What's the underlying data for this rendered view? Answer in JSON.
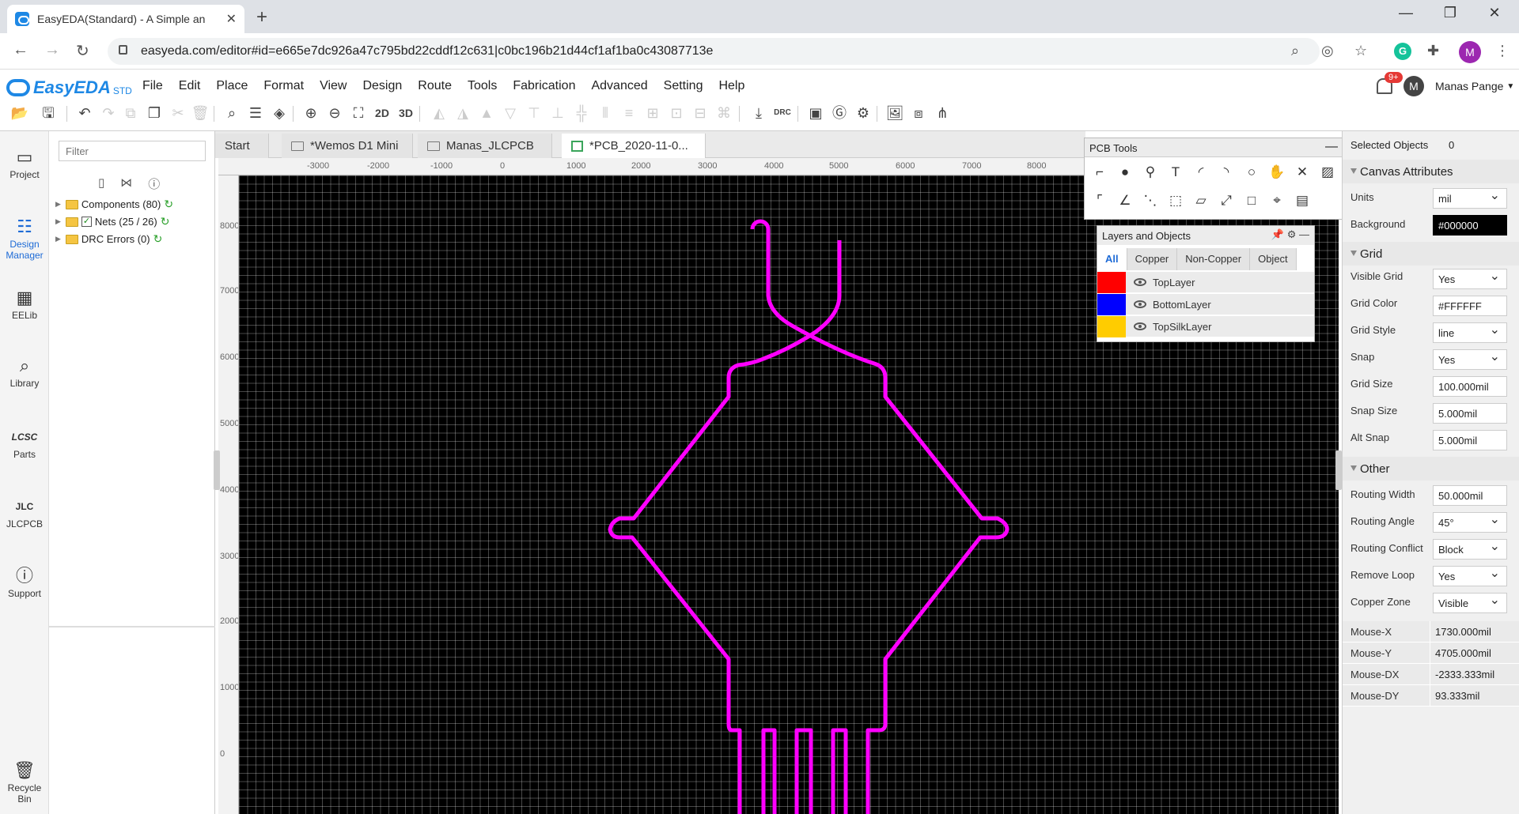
{
  "browser": {
    "tab_title": "EasyEDA(Standard) - A Simple an",
    "url": "easyeda.com/editor#id=e665e7dc926a47c795bd22cddf12c631|c0bc196b21d44cf1af1ba0c43087713e",
    "profile_initial": "M"
  },
  "app": {
    "logo": "EasyEDA",
    "logo_suffix": "STD",
    "menu": [
      "File",
      "Edit",
      "Place",
      "Format",
      "View",
      "Design",
      "Route",
      "Tools",
      "Fabrication",
      "Advanced",
      "Setting",
      "Help"
    ],
    "notification_badge": "9+",
    "user_initial": "M",
    "user_name": "Manas Pange",
    "toolbar_2d": "2D",
    "toolbar_3d": "3D",
    "toolbar_drc": "DRC"
  },
  "sidebar": [
    {
      "label": "Project",
      "icon": "folder-icon"
    },
    {
      "label": "Design Manager",
      "icon": "list-icon"
    },
    {
      "label": "EELib",
      "icon": "chip-icon"
    },
    {
      "label": "Library",
      "icon": "magnifier-icon"
    },
    {
      "label": "Parts",
      "icon": "lcsc-icon"
    },
    {
      "label": "JLCPCB",
      "icon": "jlc-icon"
    },
    {
      "label": "Support",
      "icon": "help-icon"
    },
    {
      "label": "Recycle Bin",
      "icon": "trash-icon"
    }
  ],
  "design_manager": {
    "filter_placeholder": "Filter",
    "tree": [
      "Components (80)",
      "Nets (25 / 26)",
      "DRC Errors (0)"
    ]
  },
  "doc_tabs": [
    "Start",
    "*Wemos D1 Mini",
    "Manas_JLCPCB",
    "*PCB_2020-11-0..."
  ],
  "ruler": {
    "h": [
      "-3000",
      "-2000",
      "-1000",
      "0",
      "1000",
      "2000",
      "3000",
      "4000",
      "5000",
      "6000",
      "7000",
      "8000"
    ],
    "v": [
      "8000",
      "7000",
      "6000",
      "5000",
      "4000",
      "3000",
      "2000",
      "1000",
      "0"
    ]
  },
  "pcb_tools": {
    "title": "PCB Tools"
  },
  "layers": {
    "title": "Layers and Objects",
    "tabs": [
      "All",
      "Copper",
      "Non-Copper",
      "Object"
    ],
    "rows": [
      {
        "name": "TopLayer",
        "color": "#ff0000"
      },
      {
        "name": "BottomLayer",
        "color": "#0000ff"
      },
      {
        "name": "TopSilkLayer",
        "color": "#ffcc00"
      }
    ]
  },
  "board": {
    "outline_color": "#ff00ff",
    "grid_color": "#FFFFFF",
    "background": "#000000"
  },
  "props": {
    "selected_label": "Selected Objects",
    "selected_count": "0",
    "canvas_head": "Canvas Attributes",
    "units_label": "Units",
    "units": "mil",
    "bg_label": "Background",
    "bg": "#000000",
    "grid_head": "Grid",
    "visible_grid_label": "Visible Grid",
    "visible_grid": "Yes",
    "grid_color_label": "Grid Color",
    "grid_color": "#FFFFFF",
    "grid_style_label": "Grid Style",
    "grid_style": "line",
    "snap_label": "Snap",
    "snap": "Yes",
    "grid_size_label": "Grid Size",
    "grid_size": "100.000mil",
    "snap_size_label": "Snap Size",
    "snap_size": "5.000mil",
    "alt_snap_label": "Alt Snap",
    "alt_snap": "5.000mil",
    "other_head": "Other",
    "routing_width_label": "Routing Width",
    "routing_width": "50.000mil",
    "routing_angle_label": "Routing Angle",
    "routing_angle": "45°",
    "routing_conflict_label": "Routing Conflict",
    "routing_conflict": "Block",
    "remove_loop_label": "Remove Loop",
    "remove_loop": "Yes",
    "copper_zone_label": "Copper Zone",
    "copper_zone": "Visible"
  },
  "mouse": [
    {
      "label": "Mouse-X",
      "value": "1730.000mil"
    },
    {
      "label": "Mouse-Y",
      "value": "4705.000mil"
    },
    {
      "label": "Mouse-DX",
      "value": "-2333.333mil"
    },
    {
      "label": "Mouse-DY",
      "value": "93.333mil"
    }
  ]
}
